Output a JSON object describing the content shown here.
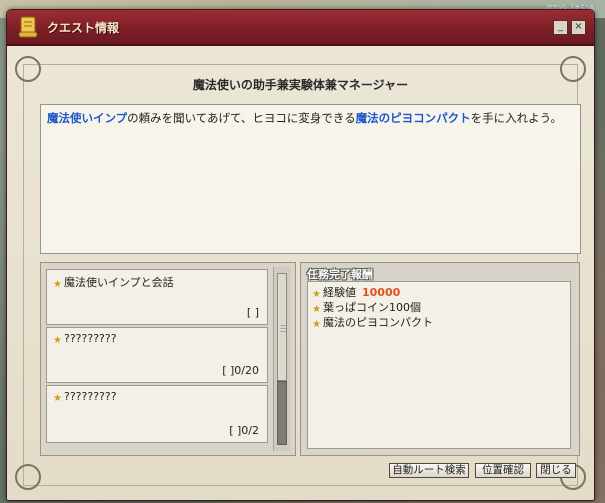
{
  "background": {
    "corner_text": "ﾛｺﾝｼ ﾐﾅﾐﾝﾄ"
  },
  "window": {
    "title": "クエスト情報",
    "buttons": {
      "minimize": "_",
      "close": "×"
    }
  },
  "quest": {
    "title": "魔法使いの助手兼実験体兼マネージャー",
    "description": {
      "part1": "魔法使いインプ",
      "part2": "の頼みを聞いてあげて、ヒヨコに変身できる",
      "part3": "魔法のピヨコンパクト",
      "part4": "を手に入れよう。"
    }
  },
  "objectives": [
    {
      "name": "魔法使いインプと会話",
      "progress": "[  ]"
    },
    {
      "name": "?????????",
      "progress": "[  ]0/20"
    },
    {
      "name": "?????????",
      "progress": "[  ]0/2"
    }
  ],
  "rewards": {
    "header": "任務完了報酬",
    "exp_label": "経験値",
    "exp_value": "10000",
    "items": [
      "葉っぱコイン100個",
      "魔法のピヨコンパクト"
    ]
  },
  "buttons": {
    "auto_route": "自動ルート検索",
    "position_check": "位置確認",
    "close": "閉じる"
  },
  "colors": {
    "title_bar": "#7e1f27",
    "highlight_blue": "#1f57c8",
    "exp_orange": "#e2501c"
  }
}
